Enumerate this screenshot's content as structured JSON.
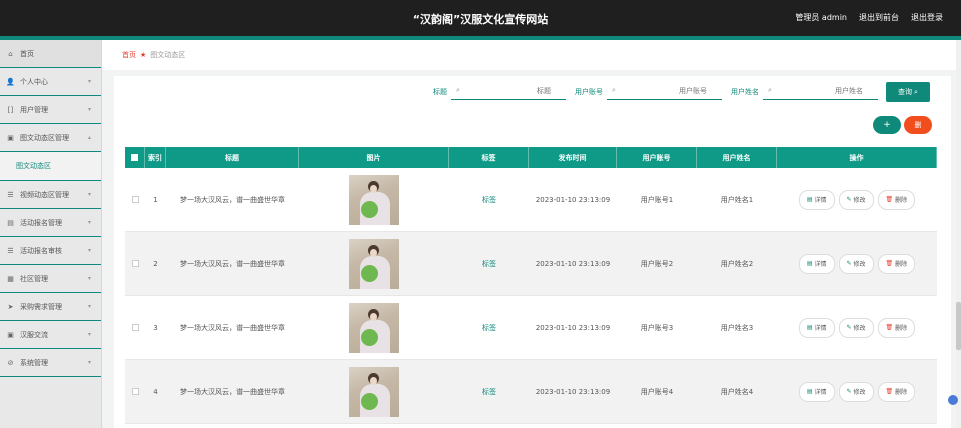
{
  "header": {
    "title": "“汉韵阁”汉服文化宣传网站",
    "user": "管理员 admin",
    "exit_front": "退出到前台",
    "logout": "退出登录"
  },
  "sidebar": {
    "items": [
      {
        "label": "首页",
        "icon": "home-icon"
      },
      {
        "label": "个人中心",
        "icon": "user-icon"
      },
      {
        "label": "用户管理",
        "icon": "users-icon"
      },
      {
        "label": "图文动态区管理",
        "icon": "image-icon"
      },
      {
        "label": "视频动态区管理",
        "icon": "video-icon"
      },
      {
        "label": "活动报名管理",
        "icon": "calendar-icon"
      },
      {
        "label": "活动报名审核",
        "icon": "check-icon"
      },
      {
        "label": "社区管理",
        "icon": "community-icon"
      },
      {
        "label": "采购需求管理",
        "icon": "cart-icon"
      },
      {
        "label": "汉服交流",
        "icon": "chat-icon"
      },
      {
        "label": "系统管理",
        "icon": "settings-icon"
      }
    ],
    "active_sub": "图文动态区"
  },
  "breadcrumb": {
    "home": "首页",
    "current": "图文动态区"
  },
  "search": {
    "title_label": "标题",
    "title_placeholder": "标题",
    "account_label": "用户账号",
    "account_placeholder": "用户账号",
    "name_label": "用户姓名",
    "name_placeholder": "用户姓名",
    "query_button": "查询"
  },
  "actions": {
    "add": "+",
    "delete": "删"
  },
  "table": {
    "headers": [
      "索引",
      "标题",
      "图片",
      "标签",
      "发布时间",
      "用户账号",
      "用户姓名",
      "操作"
    ],
    "rows": [
      {
        "index": "1",
        "title": "梦一场大汉风云，谱一曲盛世华章",
        "tag": "标签",
        "time": "2023-01-10 23:13:09",
        "account": "用户账号1",
        "name": "用户姓名1"
      },
      {
        "index": "2",
        "title": "梦一场大汉风云，谱一曲盛世华章",
        "tag": "标签",
        "time": "2023-01-10 23:13:09",
        "account": "用户账号2",
        "name": "用户姓名2"
      },
      {
        "index": "3",
        "title": "梦一场大汉风云，谱一曲盛世华章",
        "tag": "标签",
        "time": "2023-01-10 23:13:09",
        "account": "用户账号3",
        "name": "用户姓名3"
      },
      {
        "index": "4",
        "title": "梦一场大汉风云，谱一曲盛世华章",
        "tag": "标签",
        "time": "2023-01-10 23:13:09",
        "account": "用户账号4",
        "name": "用户姓名4"
      }
    ],
    "ops": {
      "detail": "详情",
      "edit": "修改",
      "remove": "删除"
    }
  },
  "colors": {
    "accent": "#0f8a7a",
    "danger": "#f24d1c",
    "topbar": "#1f1f1f"
  }
}
